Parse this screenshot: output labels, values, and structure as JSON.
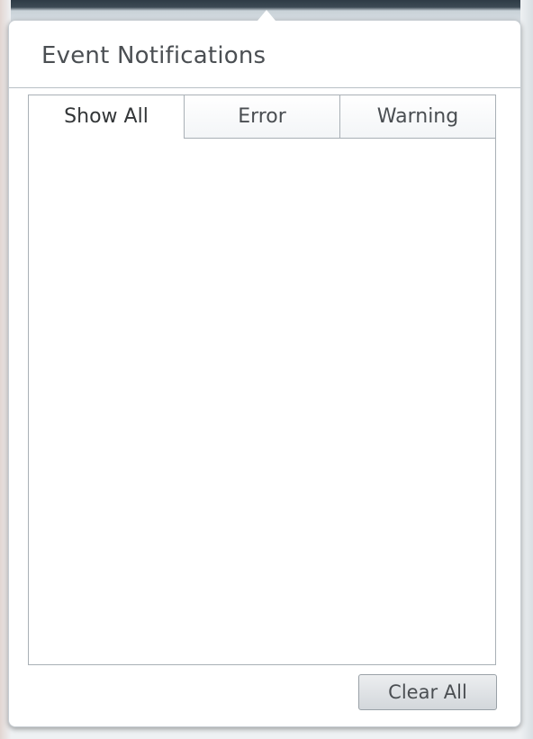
{
  "popup": {
    "title": "Event Notifications"
  },
  "tabs": [
    {
      "label": "Show All",
      "active": true
    },
    {
      "label": "Error",
      "active": false
    },
    {
      "label": "Warning",
      "active": false
    }
  ],
  "footer": {
    "clear_label": "Clear All"
  }
}
